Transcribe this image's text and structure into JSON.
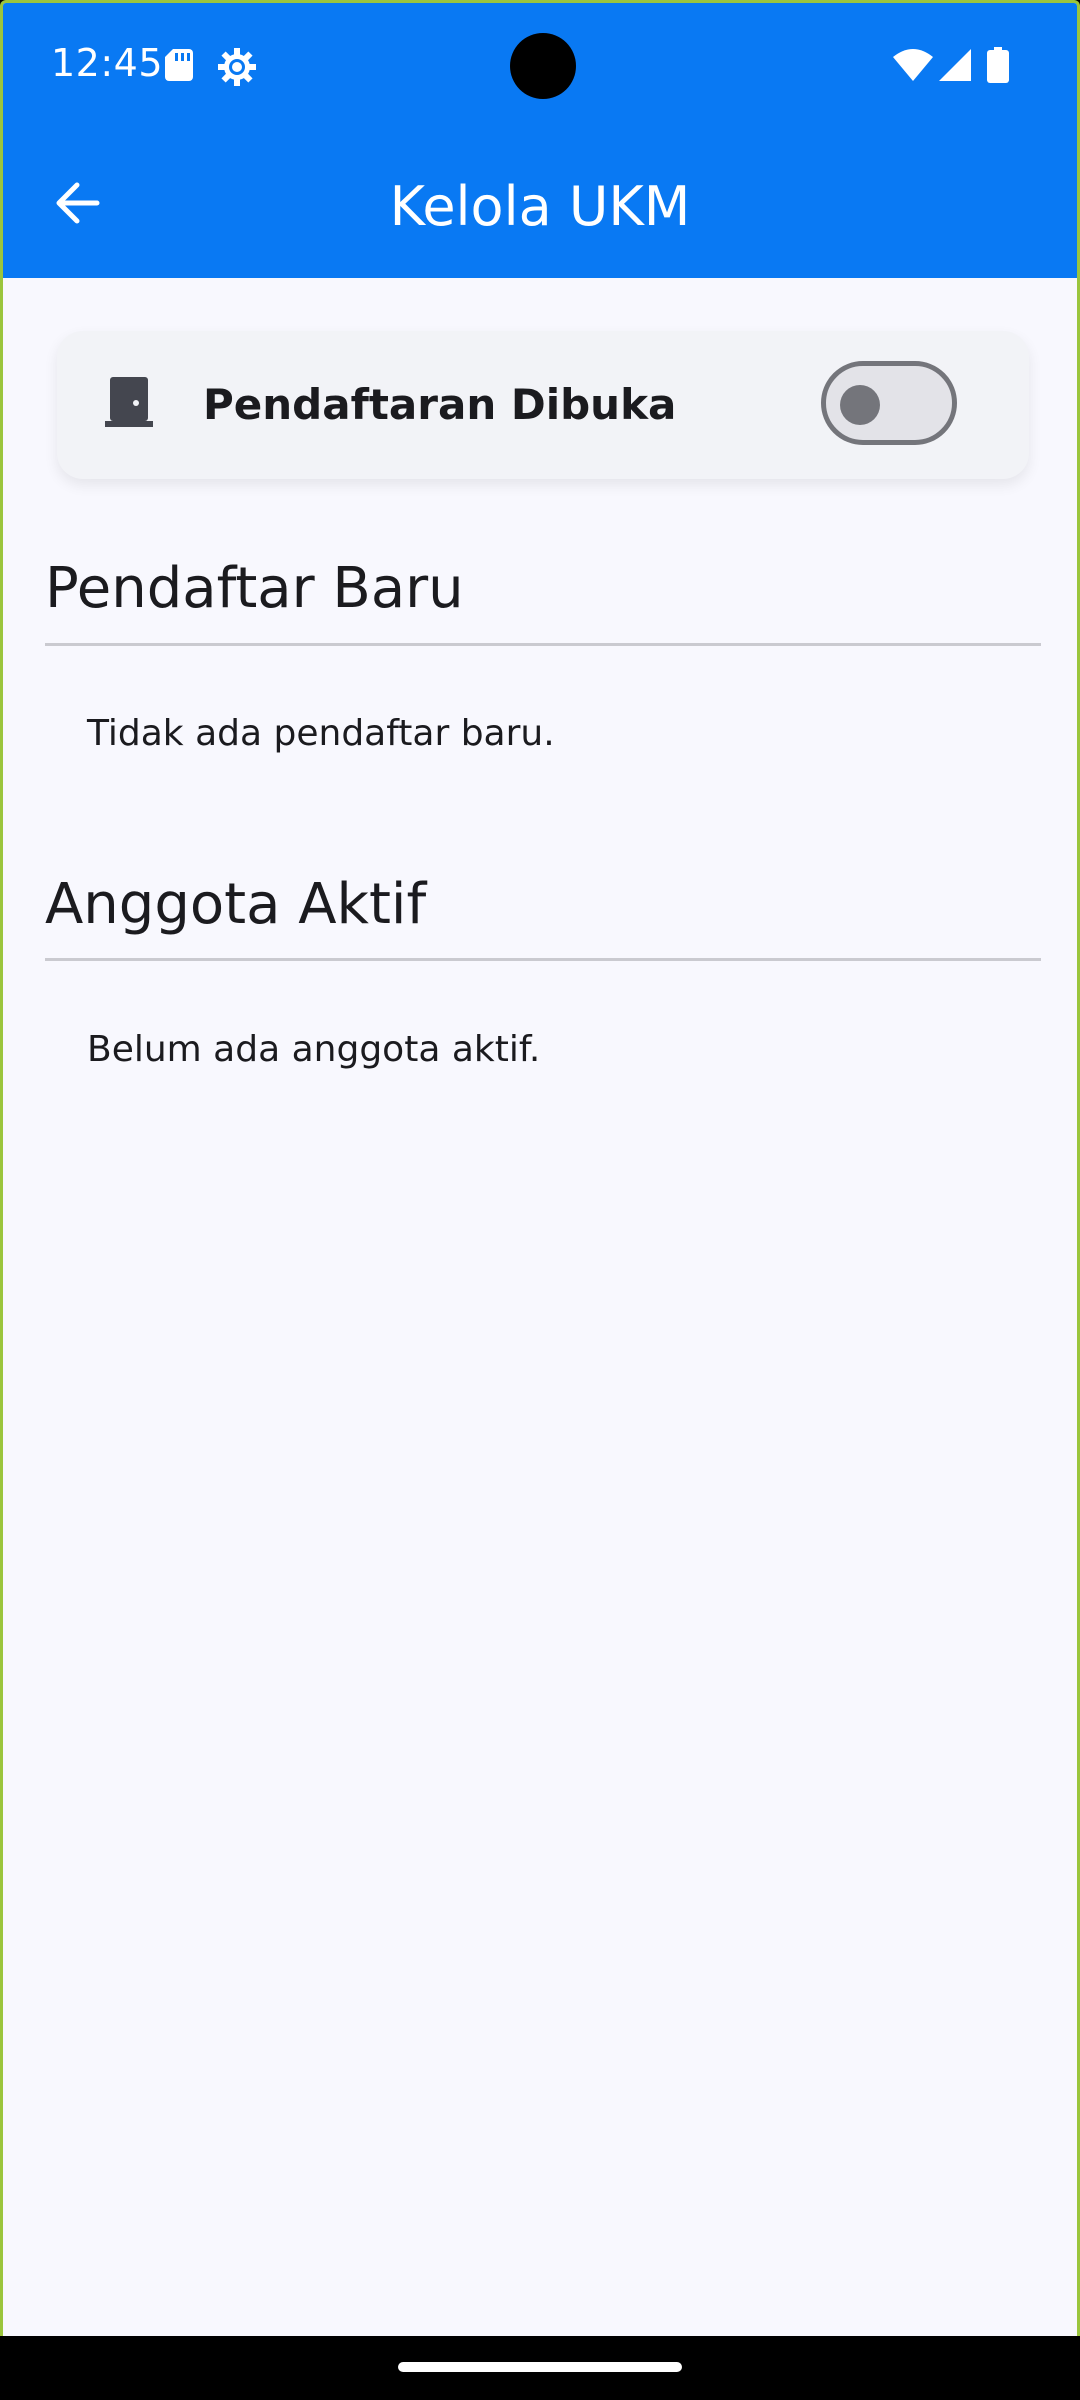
{
  "status_bar": {
    "time": "12:45",
    "icons": [
      "sd-card-icon",
      "gear-icon",
      "wifi-icon",
      "signal-icon",
      "battery-icon"
    ]
  },
  "app_bar": {
    "title": "Kelola UKM",
    "back_icon": "arrow-left-icon",
    "background": "#0979F3"
  },
  "registration_card": {
    "icon": "door-icon",
    "label": "Pendaftaran Dibuka",
    "toggle_on": false
  },
  "sections": [
    {
      "title": "Pendaftar Baru",
      "empty_text": "Tidak ada pendaftar baru."
    },
    {
      "title": "Anggota Aktif",
      "empty_text": "Belum ada anggota aktif."
    }
  ],
  "colors": {
    "page_background": "#F8F8FE",
    "card_background": "#F2F3F7",
    "text_primary": "#1B1B1F",
    "divider": "#CACAD0"
  }
}
